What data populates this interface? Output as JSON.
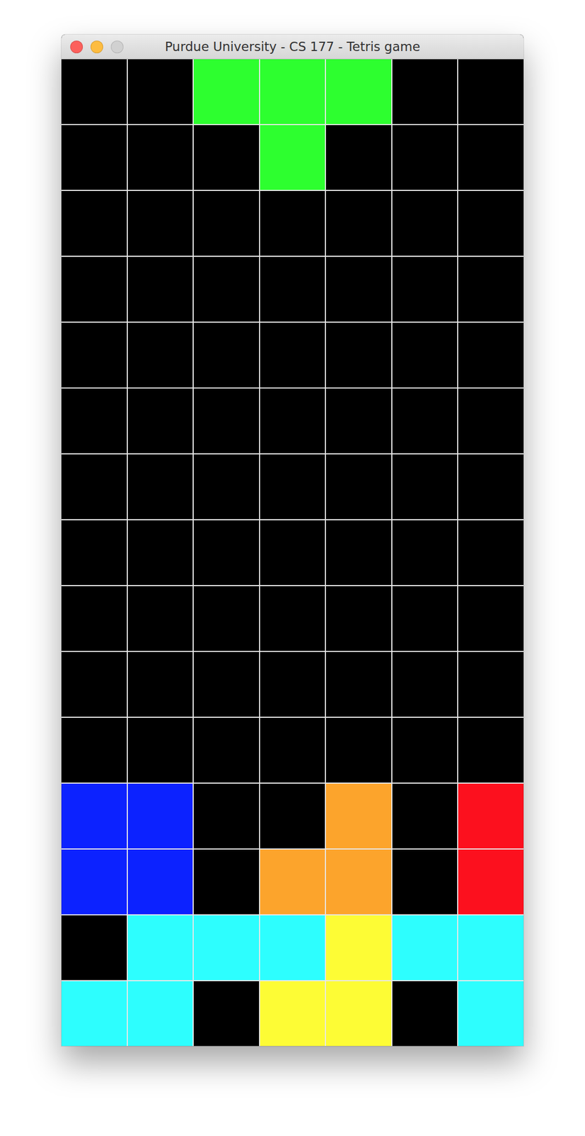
{
  "window": {
    "title": "Purdue University - CS 177 - Tetris game",
    "buttons": [
      {
        "name": "close",
        "color": "#fc605c",
        "disabled": false
      },
      {
        "name": "minimize",
        "color": "#fdbc40",
        "disabled": false
      },
      {
        "name": "zoom",
        "color": "#d0d0d0",
        "disabled": true
      }
    ]
  },
  "board": {
    "rows": [
      [
        "#000000",
        "#000000",
        "#2dff2f",
        "#2dff2f",
        "#2dff2f",
        "#000000",
        "#000000"
      ],
      [
        "#000000",
        "#000000",
        "#000000",
        "#2dff2f",
        "#000000",
        "#000000",
        "#000000"
      ],
      [
        "#000000",
        "#000000",
        "#000000",
        "#000000",
        "#000000",
        "#000000",
        "#000000"
      ],
      [
        "#000000",
        "#000000",
        "#000000",
        "#000000",
        "#000000",
        "#000000",
        "#000000"
      ],
      [
        "#000000",
        "#000000",
        "#000000",
        "#000000",
        "#000000",
        "#000000",
        "#000000"
      ],
      [
        "#000000",
        "#000000",
        "#000000",
        "#000000",
        "#000000",
        "#000000",
        "#000000"
      ],
      [
        "#000000",
        "#000000",
        "#000000",
        "#000000",
        "#000000",
        "#000000",
        "#000000"
      ],
      [
        "#000000",
        "#000000",
        "#000000",
        "#000000",
        "#000000",
        "#000000",
        "#000000"
      ],
      [
        "#000000",
        "#000000",
        "#000000",
        "#000000",
        "#000000",
        "#000000",
        "#000000"
      ],
      [
        "#000000",
        "#000000",
        "#000000",
        "#000000",
        "#000000",
        "#000000",
        "#000000"
      ],
      [
        "#000000",
        "#000000",
        "#000000",
        "#000000",
        "#000000",
        "#000000",
        "#000000"
      ],
      [
        "#0c22ff",
        "#0c22ff",
        "#000000",
        "#000000",
        "#fca42c",
        "#000000",
        "#fc101e"
      ],
      [
        "#0c22ff",
        "#0c22ff",
        "#000000",
        "#fca42c",
        "#fca42c",
        "#000000",
        "#fc101e"
      ],
      [
        "#000000",
        "#2dfefe",
        "#2dfefe",
        "#2dfefe",
        "#fdfc35",
        "#2dfefe",
        "#2dfefe"
      ],
      [
        "#2dfefe",
        "#2dfefe",
        "#000000",
        "#fdfc35",
        "#fdfc35",
        "#000000",
        "#2dfefe"
      ]
    ]
  }
}
